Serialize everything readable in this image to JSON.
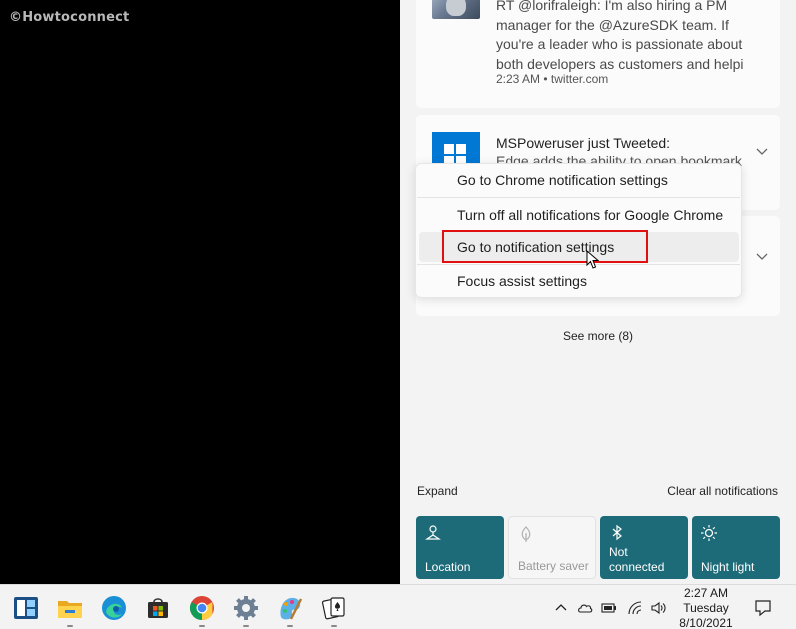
{
  "watermark": "©Howtoconnect",
  "notifications": {
    "card1": {
      "text_lines": [
        "RT @lorifraleigh: I'm also hiring a PM",
        "manager for the @AzureSDK team. If",
        "you're a leader who is passionate about",
        "both developers as customers and helpi"
      ],
      "meta": "2:23 AM • twitter.com"
    },
    "card2": {
      "title": "MSPoweruser just Tweeted:",
      "body": "Edge adds the ability to open bookmark"
    },
    "see_more": "See more (8)"
  },
  "context_menu": {
    "items": [
      "Go to Chrome notification settings",
      "Turn off all notifications for Google Chrome",
      "Go to notification settings",
      "Focus assist settings"
    ],
    "hovered_index": 2
  },
  "actions": {
    "expand": "Expand",
    "clear_all": "Clear all notifications"
  },
  "quick_actions": [
    {
      "label": "Location",
      "icon": "location-icon",
      "active": true
    },
    {
      "label": "Battery saver",
      "icon": "battery-saver-icon",
      "active": false
    },
    {
      "label": "Not connected",
      "line1": "Not",
      "line2": "connected",
      "icon": "bluetooth-icon",
      "active": true
    },
    {
      "label": "Night light",
      "icon": "night-light-icon",
      "active": true
    }
  ],
  "taskbar": {
    "apps": [
      "widgets-icon",
      "file-explorer-icon",
      "edge-icon",
      "store-icon",
      "chrome-icon",
      "settings-icon",
      "paint-icon",
      "solitaire-icon"
    ],
    "tray": [
      "chevron-up-icon",
      "onedrive-icon",
      "battery-icon",
      "wifi-icon",
      "volume-icon"
    ],
    "clock": {
      "time": "2:27 AM",
      "day": "Tuesday",
      "date": "8/10/2021"
    }
  },
  "colors": {
    "tile_active": "#1d6b78",
    "highlight": "#e01010",
    "app_blue": "#0078d4"
  }
}
